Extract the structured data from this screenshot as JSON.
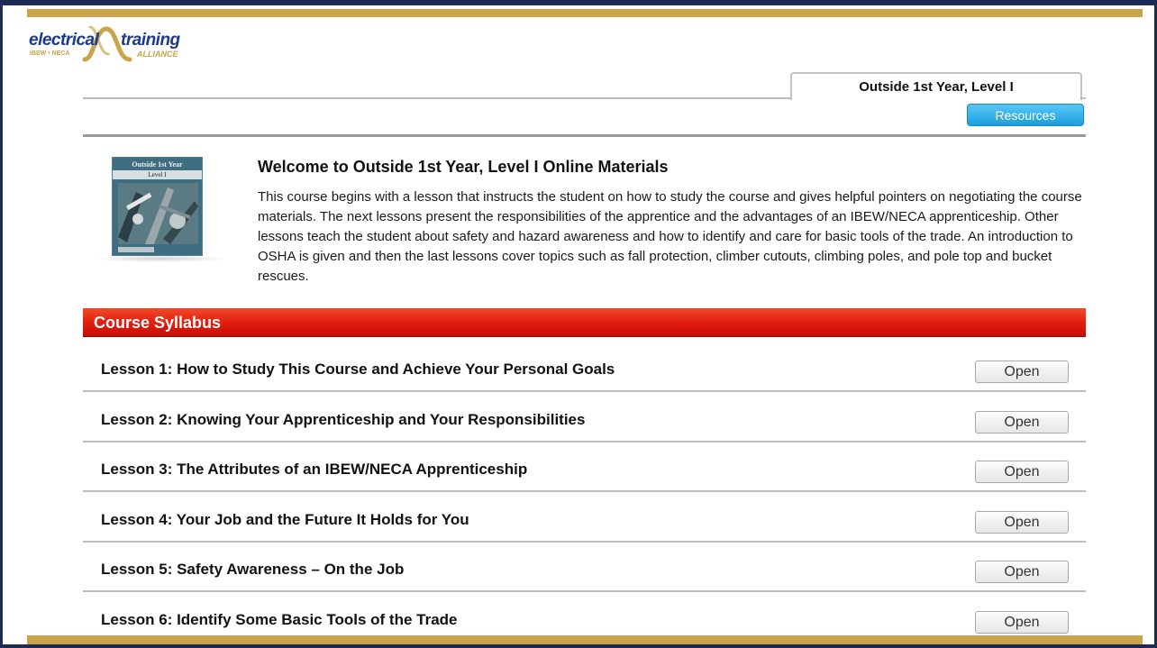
{
  "logo": {
    "word_left": "electrical",
    "word_right": "training",
    "sub_left": "IBEW • NECA",
    "sub_right": "ALLIANCE",
    "colors": {
      "blue": "#1b3a8a",
      "gold": "#c9a44a"
    }
  },
  "tab": {
    "label": "Outside 1st Year, Level I"
  },
  "resources_button": {
    "label": "Resources",
    "color": "#1b9fe0"
  },
  "cover": {
    "title": "Outside 1st Year",
    "subtitle": "Level I"
  },
  "welcome": {
    "title": "Welcome to Outside 1st Year, Level I Online Materials",
    "body": "This course begins with a lesson that instructs the student on how to study the course and gives helpful pointers on negotiating the course materials. The next lessons present the responsibilities of the apprentice and the advantages of an IBEW/NECA apprenticeship. Other lessons teach the student about safety and hazard awareness and how to identify and care for basic tools of the trade. An introduction to OSHA is given and then the last lessons cover topics such as fall protection, climber cutouts, climbing poles, and pole top and bucket rescues."
  },
  "syllabus": {
    "title": "Course Syllabus",
    "color": "#e11c0e",
    "lessons": [
      {
        "label": "Lesson 1: How to Study This Course and Achieve Your Personal Goals",
        "button": "Open"
      },
      {
        "label": "Lesson 2: Knowing Your Apprenticeship and Your Responsibilities",
        "button": "Open"
      },
      {
        "label": "Lesson 3: The Attributes of an IBEW/NECA Apprenticeship",
        "button": "Open"
      },
      {
        "label": "Lesson 4: Your Job and the Future It Holds for You",
        "button": "Open"
      },
      {
        "label": "Lesson 5: Safety Awareness – On the Job",
        "button": "Open"
      },
      {
        "label": "Lesson 6: Identify Some Basic Tools of the Trade",
        "button": "Open"
      }
    ]
  }
}
